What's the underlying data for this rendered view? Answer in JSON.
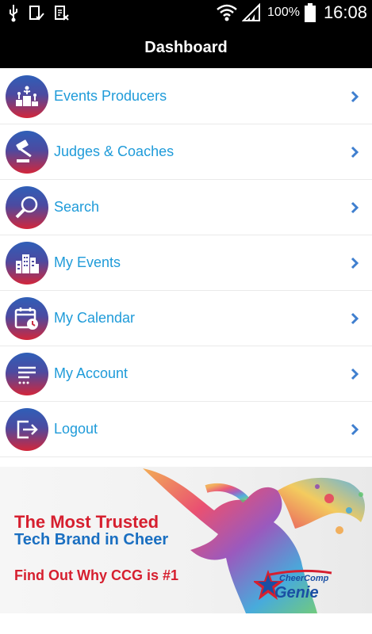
{
  "status": {
    "battery_pct": "100%",
    "time": "16:08"
  },
  "header": {
    "title": "Dashboard"
  },
  "menu": {
    "items": [
      {
        "label": "Events Producers",
        "icon": "podium-icon"
      },
      {
        "label": "Judges & Coaches",
        "icon": "gavel-icon"
      },
      {
        "label": "Search",
        "icon": "search-icon"
      },
      {
        "label": "My Events",
        "icon": "buildings-icon"
      },
      {
        "label": "My Calendar",
        "icon": "calendar-icon"
      },
      {
        "label": "My Account",
        "icon": "list-icon"
      },
      {
        "label": "Logout",
        "icon": "logout-icon"
      }
    ]
  },
  "banner": {
    "line1": "The Most Trusted",
    "line2": "Tech Brand in Cheer",
    "cta": "Find Out Why CCG is #1",
    "logo_text_1": "CheerComp",
    "logo_text_2": "Genie"
  },
  "colors": {
    "label": "#1f9bd9",
    "chevron": "#3f7fcf",
    "icon_top": "#2f5fb8",
    "icon_bottom": "#d3263a",
    "banner_red": "#d61f2f",
    "banner_blue": "#1a6fc1"
  }
}
